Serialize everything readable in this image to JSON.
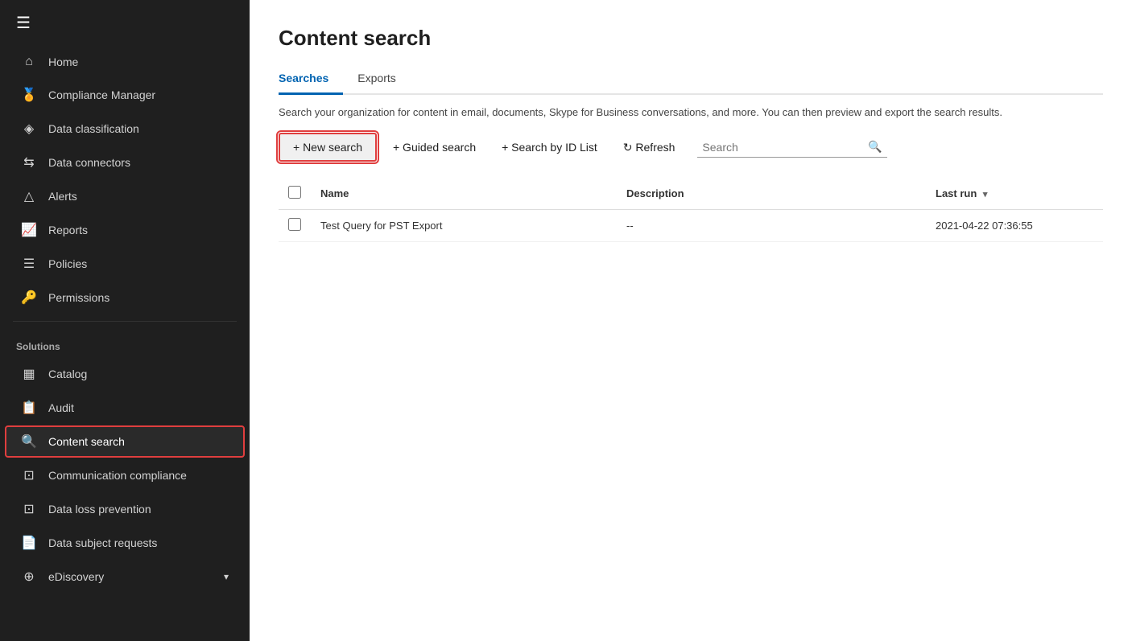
{
  "sidebar": {
    "hamburger_icon": "☰",
    "items": [
      {
        "id": "home",
        "label": "Home",
        "icon": "⌂",
        "active": false
      },
      {
        "id": "compliance-manager",
        "label": "Compliance Manager",
        "icon": "🏅",
        "active": false
      },
      {
        "id": "data-classification",
        "label": "Data classification",
        "icon": "◈",
        "active": false
      },
      {
        "id": "data-connectors",
        "label": "Data connectors",
        "icon": "⇆",
        "active": false
      },
      {
        "id": "alerts",
        "label": "Alerts",
        "icon": "△",
        "active": false
      },
      {
        "id": "reports",
        "label": "Reports",
        "icon": "📈",
        "active": false
      },
      {
        "id": "policies",
        "label": "Policies",
        "icon": "☰",
        "active": false
      },
      {
        "id": "permissions",
        "label": "Permissions",
        "icon": "🔑",
        "active": false
      }
    ],
    "solutions_label": "Solutions",
    "solutions_items": [
      {
        "id": "catalog",
        "label": "Catalog",
        "icon": "▦",
        "active": false
      },
      {
        "id": "audit",
        "label": "Audit",
        "icon": "📋",
        "active": false
      },
      {
        "id": "content-search",
        "label": "Content search",
        "icon": "🔍",
        "active": true
      },
      {
        "id": "communication-compliance",
        "label": "Communication compliance",
        "icon": "⊡",
        "active": false
      },
      {
        "id": "data-loss-prevention",
        "label": "Data loss prevention",
        "icon": "⊡",
        "active": false
      },
      {
        "id": "data-subject-requests",
        "label": "Data subject requests",
        "icon": "📄",
        "active": false
      },
      {
        "id": "ediscovery",
        "label": "eDiscovery",
        "icon": "⊕",
        "active": false
      }
    ]
  },
  "main": {
    "page_title": "Content search",
    "tabs": [
      {
        "id": "searches",
        "label": "Searches",
        "active": true
      },
      {
        "id": "exports",
        "label": "Exports",
        "active": false
      }
    ],
    "description": "Search your organization for content in email, documents, Skype for Business conversations, and more. You can then preview and export the search results.",
    "toolbar": {
      "new_search_label": "+ New search",
      "guided_search_label": "+ Guided search",
      "search_by_id_label": "+ Search by ID List",
      "refresh_label": "↻ Refresh",
      "search_placeholder": "Search"
    },
    "table": {
      "columns": [
        {
          "id": "name",
          "label": "Name",
          "sortable": false
        },
        {
          "id": "description",
          "label": "Description",
          "sortable": false
        },
        {
          "id": "last_run",
          "label": "Last run",
          "sortable": true
        }
      ],
      "rows": [
        {
          "name": "Test Query for PST Export",
          "description": "--",
          "last_run": "2021-04-22 07:36:55"
        }
      ]
    }
  }
}
